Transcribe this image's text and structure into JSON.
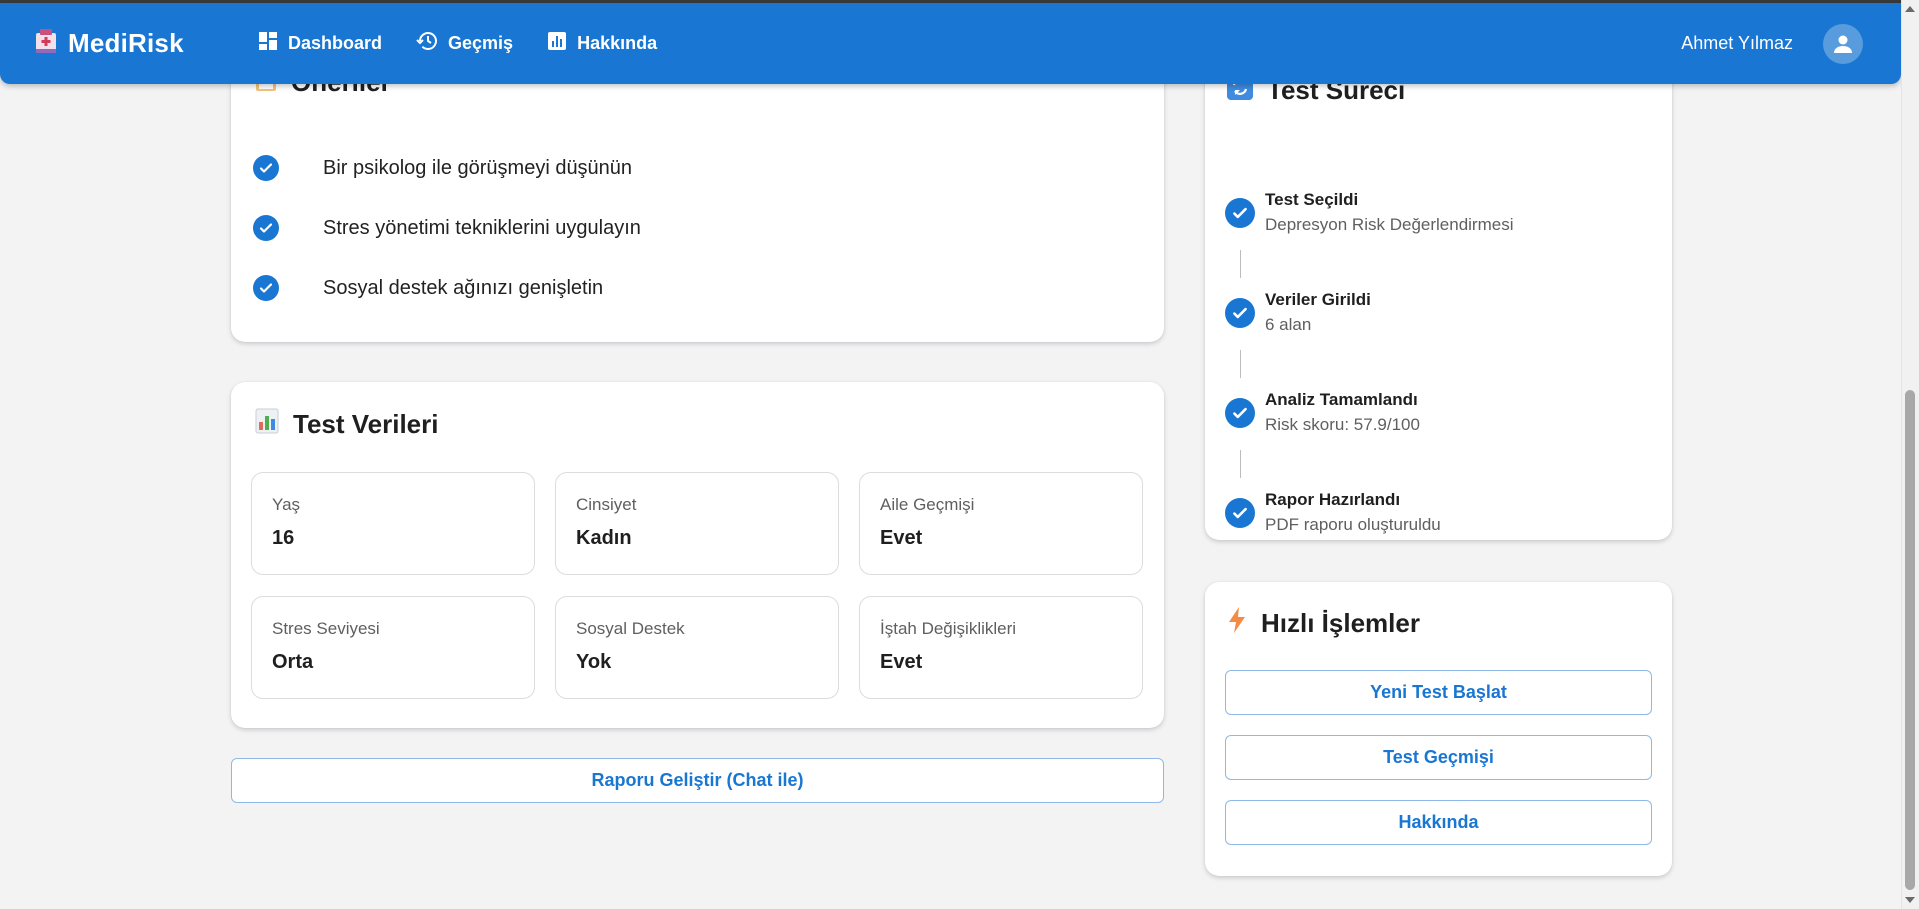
{
  "appbar": {
    "brand": "MediRisk",
    "nav": [
      {
        "label": "Dashboard",
        "icon": "dashboard-icon"
      },
      {
        "label": "Geçmiş",
        "icon": "history-icon"
      },
      {
        "label": "Hakkında",
        "icon": "bar-chart-icon"
      }
    ],
    "user_name": "Ahmet Yılmaz",
    "avatar_icon": "user-avatar-icon"
  },
  "suggestions": {
    "title": "Öneriler",
    "icon": "clipboard-icon",
    "items": [
      "Bir psikolog ile görüşmeyi düşünün",
      "Stres yönetimi tekniklerini uygulayın",
      "Sosyal destek ağınızı genişletin"
    ]
  },
  "test_data": {
    "title": "Test Verileri",
    "icon": "bar-chart-emoji-icon",
    "fields": [
      {
        "label": "Yaş",
        "value": "16"
      },
      {
        "label": "Cinsiyet",
        "value": "Kadın"
      },
      {
        "label": "Aile Geçmişi",
        "value": "Evet"
      },
      {
        "label": "Stres Seviyesi",
        "value": "Orta"
      },
      {
        "label": "Sosyal Destek",
        "value": "Yok"
      },
      {
        "label": "İştah Değişiklikleri",
        "value": "Evet"
      }
    ]
  },
  "improve_button": "Raporu Geliştir (Chat ile)",
  "process": {
    "title": "Test Süreci",
    "icon": "refresh-icon",
    "steps": [
      {
        "title": "Test Seçildi",
        "subtitle": "Depresyon Risk Değerlendirmesi"
      },
      {
        "title": "Veriler Girildi",
        "subtitle": "6 alan"
      },
      {
        "title": "Analiz Tamamlandı",
        "subtitle": "Risk skoru: 57.9/100"
      },
      {
        "title": "Rapor Hazırlandı",
        "subtitle": "PDF raporu oluşturuldu"
      }
    ]
  },
  "quick_actions": {
    "title": "Hızlı İşlemler",
    "icon": "lightning-icon",
    "buttons": [
      "Yeni Test Başlat",
      "Test Geçmişi",
      "Hakkında"
    ]
  },
  "colors": {
    "primary": "#1976d2",
    "background": "#f3f3f4",
    "card": "#ffffff",
    "muted_text": "#5f5f5f"
  }
}
